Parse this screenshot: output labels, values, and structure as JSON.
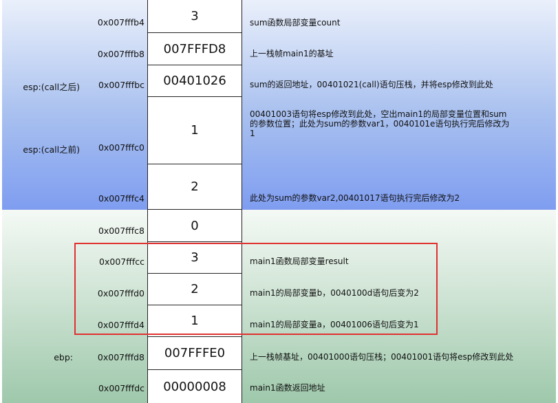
{
  "rows": [
    {
      "addr": "0x007fffb4",
      "value": "3",
      "reg": "",
      "desc": "sum函数局部变量count"
    },
    {
      "addr": "0x007fffb8",
      "value": "007FFFD8",
      "reg": "",
      "desc": "上一栈帧main1的基址"
    },
    {
      "addr": "0x007fffbc",
      "value": "00401026",
      "reg": "esp:(call之后)",
      "desc": "sum的返回地址，00401021(call)语句压栈，并将esp修改到此处"
    },
    {
      "addr": "0x007fffc0",
      "value": "1",
      "reg": "esp:(call之前)",
      "desc": "00401003语句将esp修改到此处，空出main1的局部变量位置和sum的参数位置；此处为sum的参数var1，0040101e语句执行完后修改为1"
    },
    {
      "addr": "0x007fffc4",
      "value": "2",
      "reg": "",
      "desc": "此处为sum的参数var2,00401017语句执行完后修改为2"
    },
    {
      "addr": "0x007fffc8",
      "value": "0",
      "reg": "",
      "desc": ""
    },
    {
      "addr": "0x007fffcc",
      "value": "3",
      "reg": "",
      "desc": "main1函数局部变量result"
    },
    {
      "addr": "0x007fffd0",
      "value": "2",
      "reg": "",
      "desc": "main1的局部变量b，0040100d语句后变为2"
    },
    {
      "addr": "0x007fffd4",
      "value": "1",
      "reg": "",
      "desc": "main1的局部变量a，00401006语句后变为1"
    },
    {
      "addr": "0x007fffd8",
      "value": "007FFFE0",
      "reg": "ebp:",
      "desc": "上一栈帧基址，00401000语句压栈；00401001语句将esp修改到此处"
    },
    {
      "addr": "0x007fffdc",
      "value": "00000008",
      "reg": "",
      "desc": "main1函数返回地址"
    }
  ],
  "colors": {
    "band_top": "#7f9df0",
    "band_bottom": "#9ec8ab",
    "highlight": "#e03030"
  }
}
